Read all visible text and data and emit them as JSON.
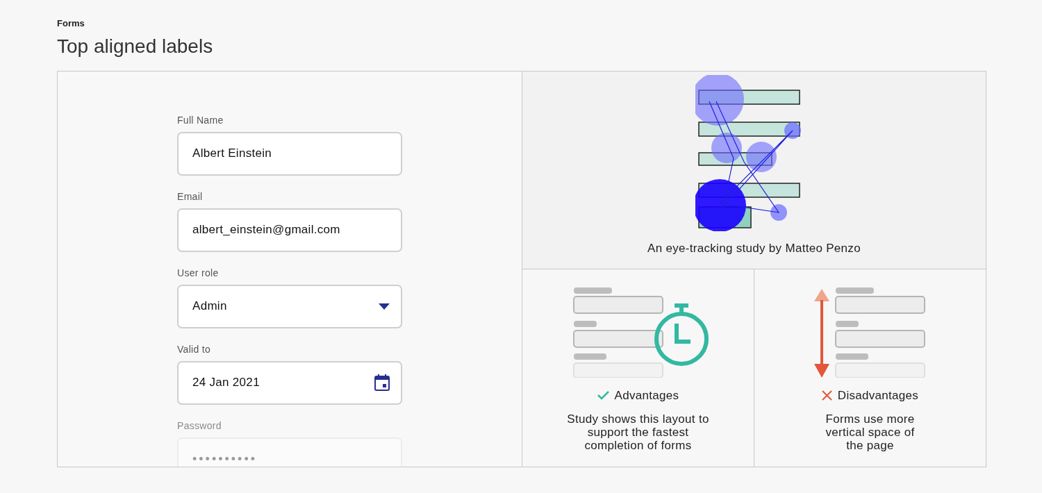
{
  "header": {
    "section": "Forms",
    "title": "Top aligned labels"
  },
  "form": {
    "fields": [
      {
        "kind": "text",
        "label": "Full Name",
        "value": "Albert Einstein"
      },
      {
        "kind": "text",
        "label": "Email",
        "value": "albert_einstein@gmail.com"
      },
      {
        "kind": "select",
        "label": "User role",
        "value": "Admin"
      },
      {
        "kind": "date",
        "label": "Valid to",
        "value": "24 Jan 2021"
      },
      {
        "kind": "password",
        "label": "Password",
        "value": "••••••••••"
      }
    ]
  },
  "study": {
    "kind": "picture",
    "caption": "An eye-tracking study by Matteo Penzo"
  },
  "points": [
    {
      "kind": "advantage",
      "heading": "Advantages",
      "text": "Study shows this layout to support the fastest completion of forms"
    },
    {
      "kind": "disadvantage",
      "heading": "Disadvantages",
      "text": "Forms use more vertical space of the page"
    }
  ]
}
